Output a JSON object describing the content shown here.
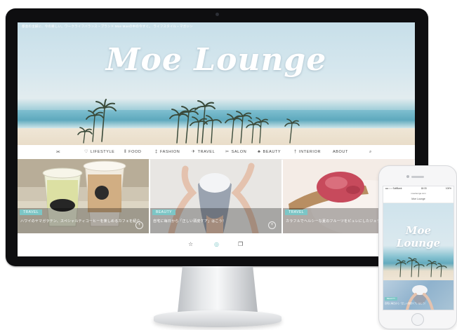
{
  "site": {
    "tagline": "都会の主婦に、今の楽しい。ワークライフバランス・ブランド Moe Moeの中の今すぐ。 ライフスタイル・マガジン",
    "logo": "Moe Lounge"
  },
  "nav": {
    "items": [
      {
        "label": "",
        "icon": "share-icon"
      },
      {
        "label": "LIFESTYLE",
        "icon": "heart-icon"
      },
      {
        "label": "FOOD",
        "icon": "fork-icon"
      },
      {
        "label": "FASHION",
        "icon": "hanger-icon"
      },
      {
        "label": "TRAVEL",
        "icon": "plane-icon"
      },
      {
        "label": "SALON",
        "icon": "scissors-icon"
      },
      {
        "label": "BEAUTY",
        "icon": "lipstick-icon"
      },
      {
        "label": "INTERIOR",
        "icon": "lamp-icon"
      },
      {
        "label": "ABOUT",
        "icon": ""
      },
      {
        "label": "",
        "icon": "search-icon"
      }
    ]
  },
  "cards": [
    {
      "category": "TRAVEL",
      "title": "ハワイのヤマガラテン、スペシャルティコーヒーを楽しめるカフェを紹介",
      "colors": [
        "#d9d2a8",
        "#b9c48e",
        "#efe6c8"
      ]
    },
    {
      "category": "BEAUTY",
      "title": "自宅に毎日から「正しい頭皮ケア」はこう！",
      "colors": [
        "#e8e6e4",
        "#c9c3bf",
        "#f2efee"
      ]
    },
    {
      "category": "TRAVEL",
      "title": "カラフルでヘルシーな夏のフルーツをピュレにしたジェラート最強スイーツ",
      "colors": [
        "#f2d8d6",
        "#c94f5f",
        "#f6ede8"
      ]
    }
  ],
  "bottom_icons": [
    "star-icon",
    "eye-icon",
    "bookmark-icon"
  ],
  "phone": {
    "time": "18:33",
    "carrier": "●●○○○ SoftBank",
    "battery": "100%",
    "url": "moelounge.com",
    "logo": "Moe Lounge",
    "card_category": "BEAUTY",
    "card_title": "自宅に毎日から「正しい頭皮ケア」はこう！"
  },
  "colors": {
    "accent": "#7cc6c6",
    "bezel": "#0e0e10"
  }
}
